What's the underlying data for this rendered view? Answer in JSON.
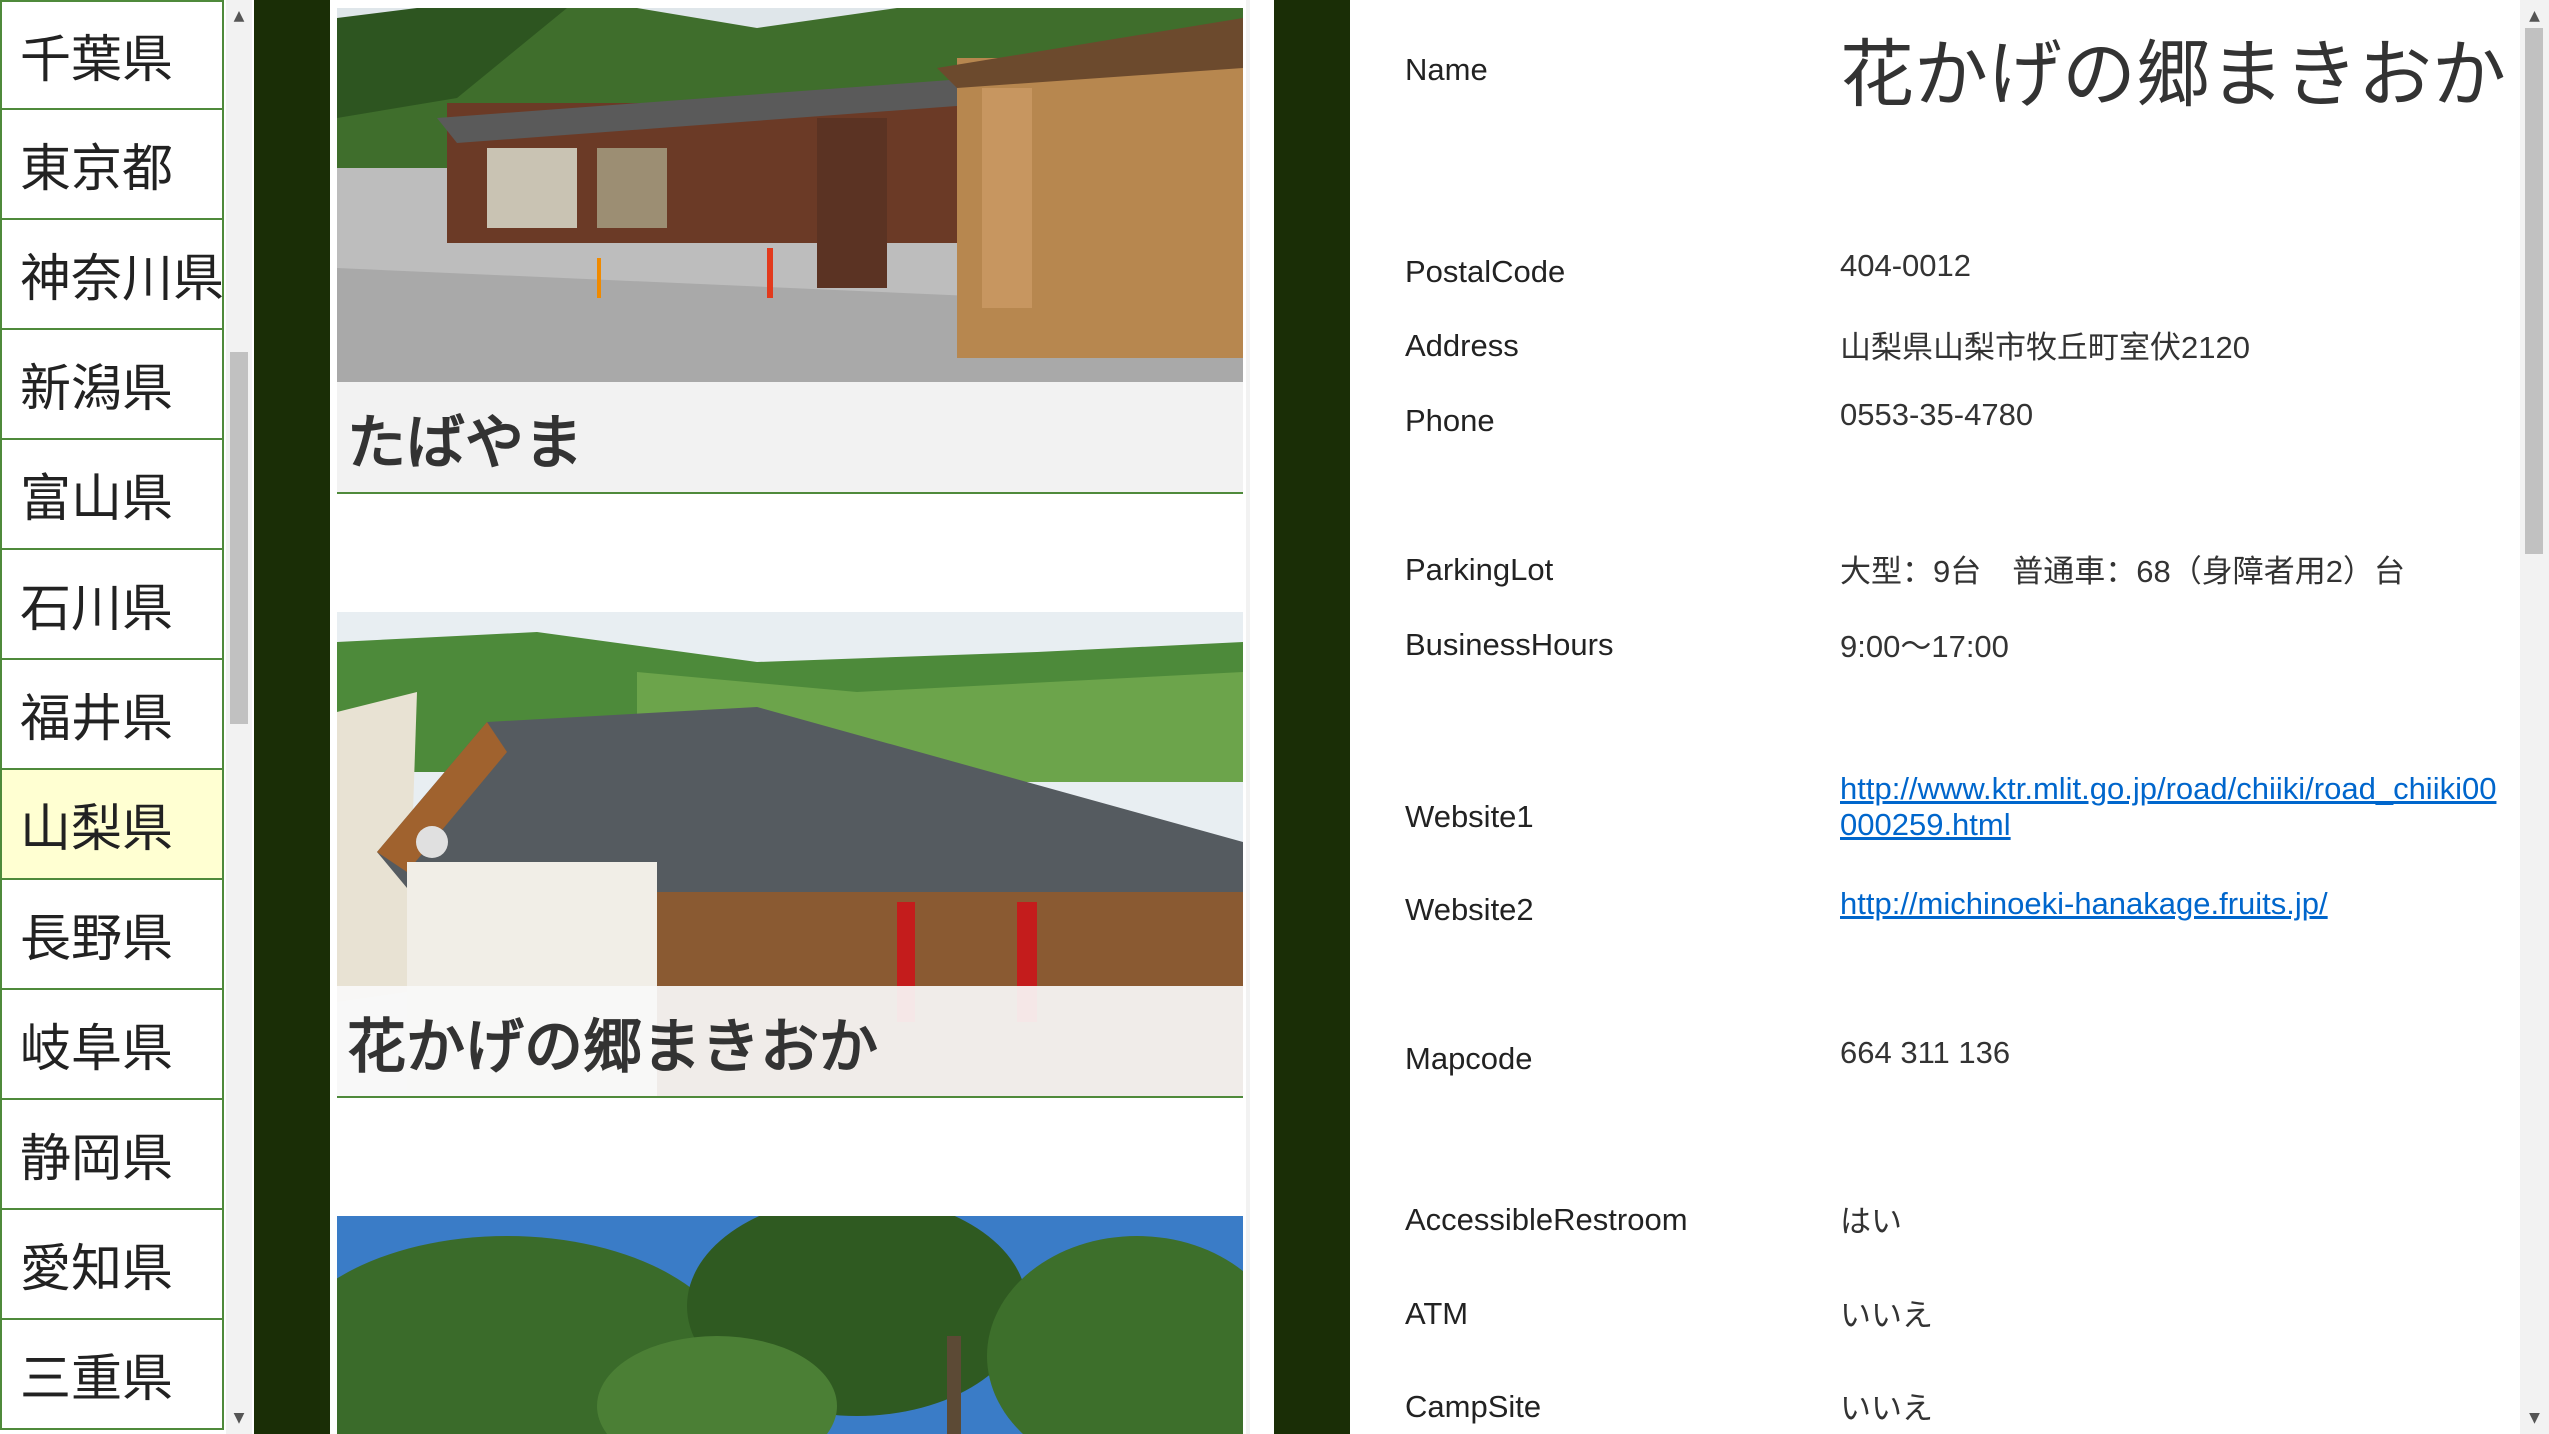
{
  "prefectures": [
    "千葉県",
    "東京都",
    "神奈川県",
    "新潟県",
    "富山県",
    "石川県",
    "福井県",
    "山梨県",
    "長野県",
    "岐阜県",
    "静岡県",
    "愛知県",
    "三重県"
  ],
  "selected_prefecture": "山梨県",
  "stations": [
    {
      "name": "たばやま"
    },
    {
      "name": "花かげの郷まきおか"
    },
    {
      "name": ""
    }
  ],
  "scroll_arrows": {
    "up": "▲",
    "down": "▼"
  },
  "detail": {
    "name_label": "Name",
    "name_value": "花かげの郷まきおか",
    "fields": [
      {
        "label": "PostalCode",
        "value": "404-0012"
      },
      {
        "label": "Address",
        "value": "山梨県山梨市牧丘町室伏2120"
      },
      {
        "label": "Phone",
        "value": "0553-35-4780"
      },
      {
        "label": "ParkingLot",
        "value": "大型：9台　普通車：68（身障者用2）台"
      },
      {
        "label": "BusinessHours",
        "value": "9:00〜17:00"
      },
      {
        "label": "Website1",
        "value": "http://www.ktr.mlit.go.jp/road/chiiki/road_chiiki00000259.html"
      },
      {
        "label": "Website2",
        "value": "http://michinoeki-hanakage.fruits.jp/"
      },
      {
        "label": "Mapcode",
        "value": "664 311 136"
      },
      {
        "label": "AccessibleRestroom",
        "value": "はい"
      },
      {
        "label": "ATM",
        "value": "いいえ"
      },
      {
        "label": "CampSite",
        "value": "いいえ"
      }
    ]
  }
}
